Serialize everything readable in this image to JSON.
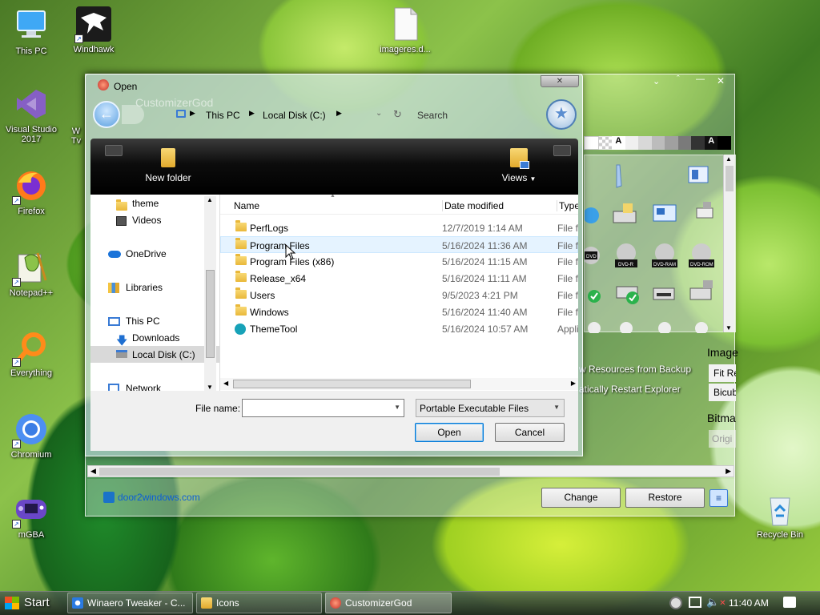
{
  "desktop_icons": [
    {
      "label": "This PC",
      "name": "this-pc-icon"
    },
    {
      "label": "Windhawk",
      "name": "windhawk-icon"
    },
    {
      "label": "imageres.d...",
      "name": "file-icon"
    },
    {
      "label": "Visual Studio 2017",
      "name": "visual-studio-icon"
    },
    {
      "label": "Firefox",
      "name": "firefox-icon"
    },
    {
      "label": "Notepad++",
      "name": "notepadpp-icon"
    },
    {
      "label": "Everything",
      "name": "everything-icon"
    },
    {
      "label": "Chromium",
      "name": "chromium-icon"
    },
    {
      "label": "mGBA",
      "name": "mgba-icon"
    },
    {
      "label": "Recycle Bin",
      "name": "recycle-bin-icon"
    }
  ],
  "partial_icon_label": "W\nTv",
  "dialog": {
    "title": "Open",
    "ghost_title": "CustomizerGod",
    "breadcrumb": [
      "This PC",
      "Local Disk (C:)"
    ],
    "search_placeholder": "Search",
    "toolbar": {
      "new_folder": "New folder",
      "views": "Views"
    },
    "nav": [
      "theme",
      "Videos",
      "OneDrive",
      "Libraries",
      "This PC",
      "Downloads",
      "Local Disk (C:)",
      "Network"
    ],
    "columns": {
      "name": "Name",
      "date": "Date modified",
      "type": "Type"
    },
    "files": [
      {
        "name": "PerfLogs",
        "date": "12/7/2019 1:14 AM",
        "type": "File fo"
      },
      {
        "name": "Program Files",
        "date": "5/16/2024 11:36 AM",
        "type": "File fo"
      },
      {
        "name": "Program Files (x86)",
        "date": "5/16/2024 11:15 AM",
        "type": "File fo"
      },
      {
        "name": "Release_x64",
        "date": "5/16/2024 11:11 AM",
        "type": "File fo"
      },
      {
        "name": "Users",
        "date": "9/5/2023 4:21 PM",
        "type": "File fo"
      },
      {
        "name": "Windows",
        "date": "5/16/2024 11:40 AM",
        "type": "File fo"
      },
      {
        "name": "ThemeTool",
        "date": "5/16/2024 10:57 AM",
        "type": "Appli"
      }
    ],
    "file_name_label": "File name:",
    "file_name_value": "",
    "file_type": "Portable Executable Files",
    "open_button": "Open",
    "cancel_button": "Cancel"
  },
  "customizer": {
    "restore_backup": "w Resources from Backup",
    "restart_explorer": "atically Restart Explorer",
    "image_label": "Image",
    "fit_label": "Fit Re",
    "bicubic_label": "Bicub",
    "bitmap_label": "Bitma",
    "orig_label": "Origi",
    "link": "door2windows.com",
    "change_button": "Change",
    "restore_button": "Restore",
    "palette_letter": "A",
    "dvd_labels": [
      "DVD",
      "DVD-R",
      "DVD-RAM",
      "DVD-ROM"
    ]
  },
  "taskbar": {
    "start": "Start",
    "buttons": [
      "Winaero Tweaker - C...",
      "Icons",
      "CustomizerGod"
    ],
    "time": "11:40 AM"
  }
}
